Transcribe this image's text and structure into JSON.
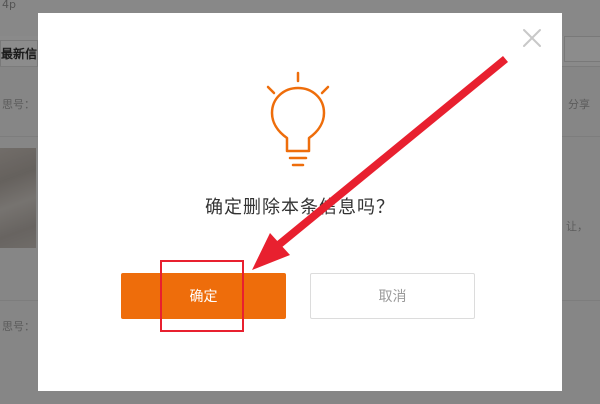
{
  "background_page": {
    "top_fragment": "4p",
    "active_tab_label": "最新信",
    "row_fragments": [
      "思号：",
      "思号：",
      "思号："
    ],
    "right_fragments": [
      "分享",
      "让，"
    ]
  },
  "dialog": {
    "close_icon": "close-icon",
    "bulb_icon": "lightbulb-icon",
    "message": "确定删除本条信息吗？",
    "confirm_label": "确定",
    "cancel_label": "取消"
  },
  "colors": {
    "accent": "#ee6d0b",
    "annotation": "#e8202f",
    "overlay": "rgba(0,0,0,0.45)",
    "close": "#c8c8c8"
  }
}
